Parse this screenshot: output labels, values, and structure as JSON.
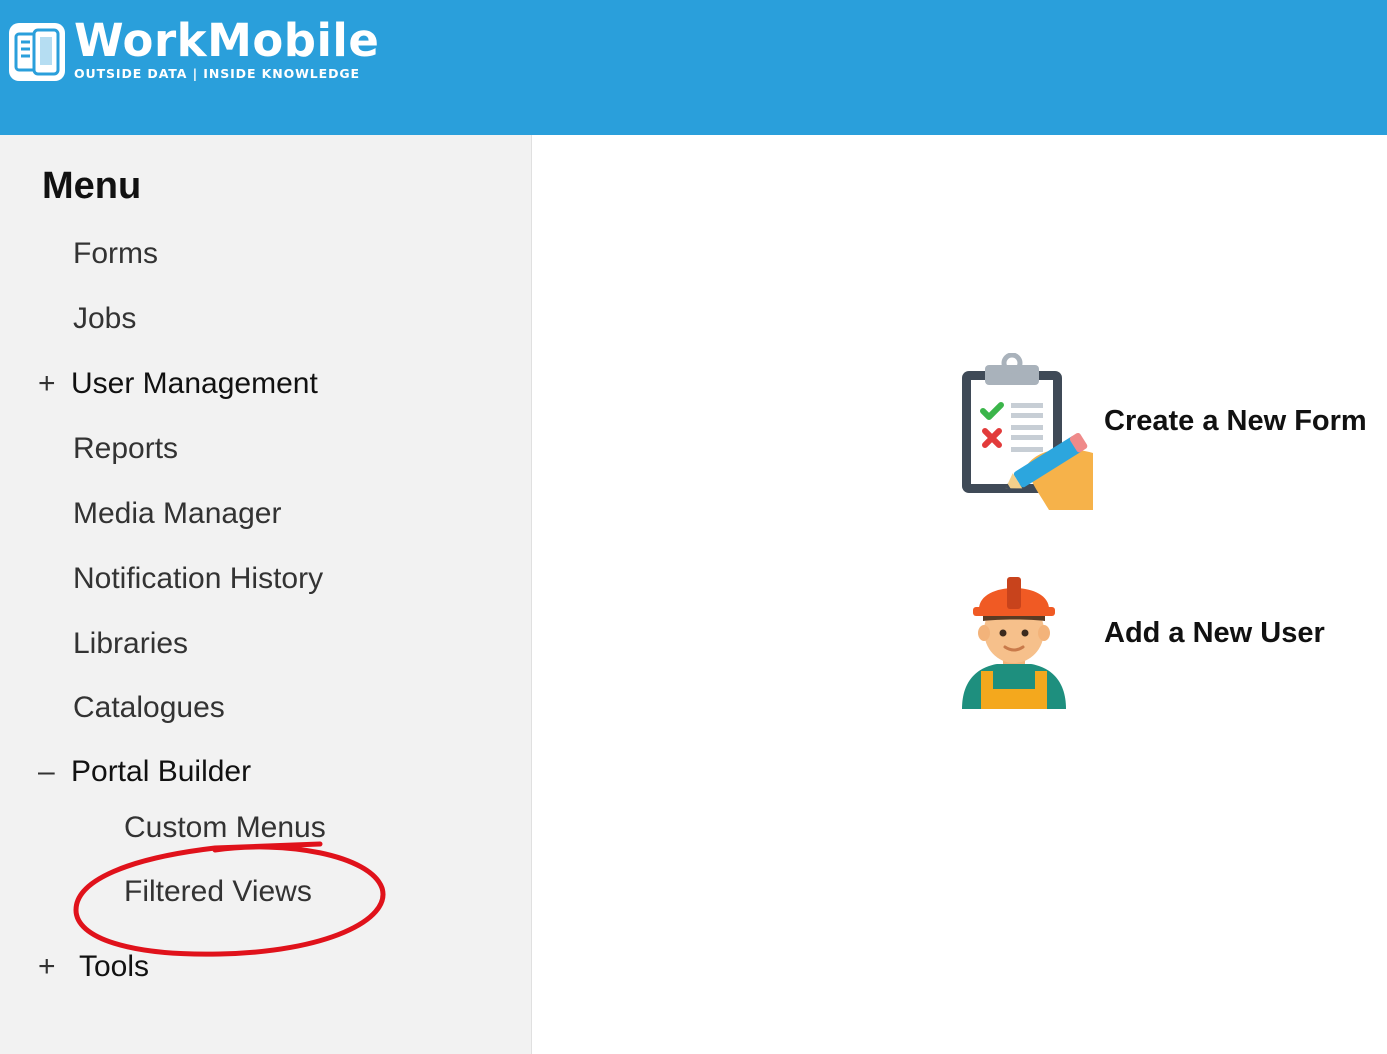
{
  "header": {
    "logo_name": "WorkMobile",
    "logo_tagline": "OUTSIDE DATA | INSIDE KNOWLEDGE",
    "brand_color": "#2a9fdb"
  },
  "sidebar": {
    "title": "Menu",
    "items": [
      {
        "label": "Forms"
      },
      {
        "label": "Jobs"
      },
      {
        "label": "User Management",
        "expander": "+"
      },
      {
        "label": "Reports"
      },
      {
        "label": "Media Manager"
      },
      {
        "label": "Notification History"
      },
      {
        "label": "Libraries"
      },
      {
        "label": "Catalogues"
      },
      {
        "label": "Portal Builder",
        "expander": "–"
      },
      {
        "label": "Custom Menus"
      },
      {
        "label": "Filtered Views"
      },
      {
        "label": "Tools",
        "expander": "+"
      }
    ]
  },
  "main": {
    "actions": [
      {
        "label": "Create a New Form",
        "icon": "clipboard-checklist-icon"
      },
      {
        "label": "Add a New User",
        "icon": "worker-user-icon"
      }
    ]
  },
  "annotation": {
    "color": "#e0121b"
  }
}
